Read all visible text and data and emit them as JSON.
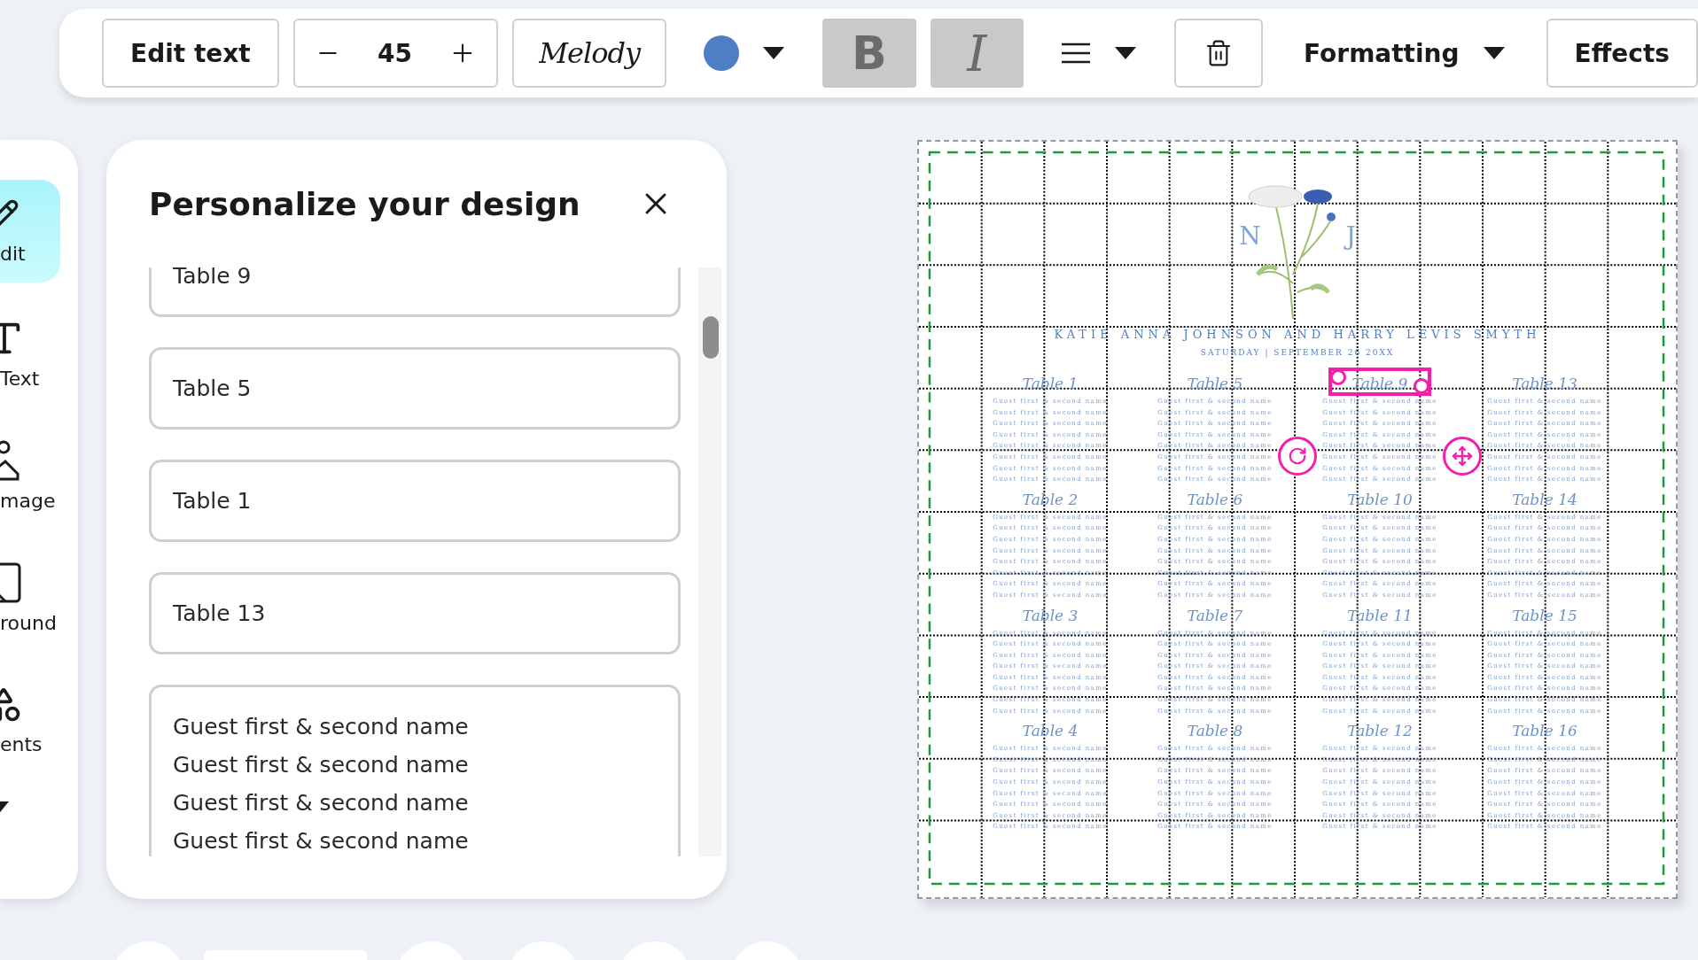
{
  "toolbar": {
    "edit_text": "Edit text",
    "size": "45",
    "font": "Melody",
    "color": "#4f7ec4",
    "bold": {
      "label": "B",
      "selected": true
    },
    "italic": {
      "label": "I",
      "selected": true
    },
    "formatting": "Formatting",
    "effects": "Effects"
  },
  "sidebar": {
    "items": [
      {
        "kind": "edit",
        "label": "dit",
        "selected": true
      },
      {
        "kind": "text",
        "label": "Text",
        "selected": false
      },
      {
        "kind": "image",
        "label": "mage",
        "selected": false
      },
      {
        "kind": "background",
        "label": "round",
        "selected": false
      },
      {
        "kind": "elements",
        "label": "ents",
        "selected": false
      },
      {
        "kind": "more",
        "selected": false
      }
    ]
  },
  "panel": {
    "title": "Personalize your design",
    "fields": [
      {
        "kind": "line",
        "value": "Table 9"
      },
      {
        "kind": "line",
        "value": "Table 5"
      },
      {
        "kind": "line",
        "value": "Table 1"
      },
      {
        "kind": "line",
        "value": "Table 13"
      },
      {
        "kind": "lines",
        "value": [
          "Guest first & second name",
          "Guest first & second name",
          "Guest first & second name",
          "Guest first & second name"
        ]
      }
    ]
  },
  "design": {
    "monogram": [
      "N",
      "J"
    ],
    "names": "KATIE ANNA JOHNSON AND HARRY LEVIS SMYTH",
    "date": "SATURDAY | SEPTEMBER 26 20XX",
    "tables": [
      {
        "title": "Table 1",
        "guests": [
          "Guest first & second name",
          "Guest first & second name",
          "Guest first & second name",
          "Guest first & second name",
          "Guest first & second name",
          "Guest first & second name",
          "Guest first & second name",
          "Guest first & second name"
        ]
      },
      {
        "title": "Table 5",
        "guests": [
          "Guest first & second name",
          "Guest first & second name",
          "Guest first & second name",
          "Guest first & second name",
          "Guest first & second name",
          "Guest first & second name",
          "Guest first & second name",
          "Guest first & second name"
        ]
      },
      {
        "title": "Table 9",
        "selected": true,
        "guests": [
          "Guest first & second name",
          "Guest first & second name",
          "Guest first & second name",
          "Guest first & second name",
          "Guest first & second name",
          "Guest first & second name",
          "Guest first & second name",
          "Guest first & second name"
        ]
      },
      {
        "title": "Table 13",
        "guests": [
          "Guest first & second name",
          "Guest first & second name",
          "Guest first & second name",
          "Guest first & second name",
          "Guest first & second name",
          "Guest first & second name",
          "Guest first & second name",
          "Guest first & second name"
        ]
      },
      {
        "title": "Table 2",
        "guests": [
          "Guest first & second name",
          "Guest first & second name",
          "Guest first & second name",
          "Guest first & second name",
          "Guest first & second name",
          "Guest first & second name",
          "Guest first & second name",
          "Guest first & second name"
        ]
      },
      {
        "title": "Table 6",
        "guests": [
          "Guest first & second name",
          "Guest first & second name",
          "Guest first & second name",
          "Guest first & second name",
          "Guest first & second name",
          "Guest first & second name",
          "Guest first & second name",
          "Guest first & second name"
        ]
      },
      {
        "title": "Table 10",
        "guests": [
          "Guest first & second name",
          "Guest first & second name",
          "Guest first & second name",
          "Guest first & second name",
          "Guest first & second name",
          "Guest first & second name",
          "Guest first & second name",
          "Guest first & second name"
        ]
      },
      {
        "title": "Table 14",
        "guests": [
          "Guest first & second name",
          "Guest first & second name",
          "Guest first & second name",
          "Guest first & second name",
          "Guest first & second name",
          "Guest first & second name",
          "Guest first & second name",
          "Guest first & second name"
        ]
      },
      {
        "title": "Table 3",
        "guests": [
          "Guest first & second name",
          "Guest first & second name",
          "Guest first & second name",
          "Guest first & second name",
          "Guest first & second name",
          "Guest first & second name",
          "Guest first & second name",
          "Guest first & second name"
        ]
      },
      {
        "title": "Table 7",
        "guests": [
          "Guest first & second name",
          "Guest first & second name",
          "Guest first & second name",
          "Guest first & second name",
          "Guest first & second name",
          "Guest first & second name",
          "Guest first & second name",
          "Guest first & second name"
        ]
      },
      {
        "title": "Table 11",
        "guests": [
          "Guest first & second name",
          "Guest first & second name",
          "Guest first & second name",
          "Guest first & second name",
          "Guest first & second name",
          "Guest first & second name",
          "Guest first & second name",
          "Guest first & second name"
        ]
      },
      {
        "title": "Table 15",
        "guests": [
          "Guest first & second name",
          "Guest first & second name",
          "Guest first & second name",
          "Guest first & second name",
          "Guest first & second name",
          "Guest first & second name",
          "Guest first & second name",
          "Guest first & second name"
        ]
      },
      {
        "title": "Table 4",
        "guests": [
          "Guest first & second name",
          "Guest first & second name",
          "Guest first & second name",
          "Guest first & second name",
          "Guest first & second name",
          "Guest first & second name",
          "Guest first & second name",
          "Guest first & second name"
        ]
      },
      {
        "title": "Table 8",
        "guests": [
          "Guest first & second name",
          "Guest first & second name",
          "Guest first & second name",
          "Guest first & second name",
          "Guest first & second name",
          "Guest first & second name",
          "Guest first & second name",
          "Guest first & second name"
        ]
      },
      {
        "title": "Table 12",
        "guests": [
          "Guest first & second name",
          "Guest first & second name",
          "Guest first & second name",
          "Guest first & second name",
          "Guest first & second name",
          "Guest first & second name",
          "Guest first & second name",
          "Guest first & second name"
        ]
      },
      {
        "title": "Table 16",
        "guests": [
          "Guest first & second name",
          "Guest first & second name",
          "Guest first & second name",
          "Guest first & second name",
          "Guest first & second name",
          "Guest first & second name",
          "Guest first & second name",
          "Guest first & second name"
        ]
      }
    ]
  }
}
